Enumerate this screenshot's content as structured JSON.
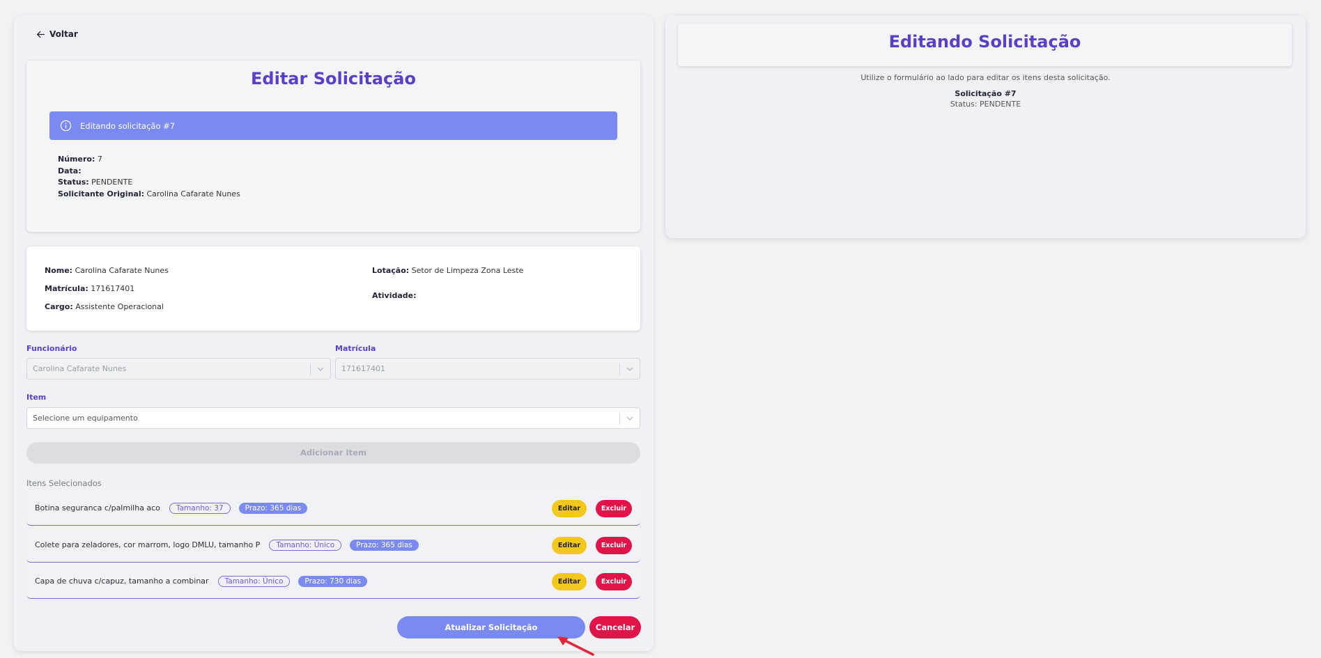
{
  "back_label": "Voltar",
  "left": {
    "title": "Editar Solicitação",
    "alert_text": "Editando solicitação #7",
    "details": [
      {
        "label": "Número:",
        "value": " 7"
      },
      {
        "label": "Data:",
        "value": ""
      },
      {
        "label": "Status:",
        "value": " PENDENTE"
      },
      {
        "label": "Solicitante Original:",
        "value": " Carolina Cafarate Nunes"
      }
    ]
  },
  "employee_info": {
    "nome_label": "Nome:",
    "nome": " Carolina Cafarate Nunes",
    "matricula_label": "Matrícula:",
    "matricula": " 171617401",
    "cargo_label": "Cargo:",
    "cargo": " Assistente Operacional",
    "lotacao_label": "Lotação:",
    "lotacao": " Setor de Limpeza Zona Leste",
    "atividade_label": "Atividade:",
    "atividade": ""
  },
  "form": {
    "funcionario_label": "Funcionário",
    "funcionario_value": "Carolina Cafarate Nunes",
    "matricula_label": "Matrícula",
    "matricula_value": "171617401",
    "item_label": "Item",
    "item_placeholder": "Selecione um equipamento",
    "add_button": "Adicionar Item"
  },
  "selected_items_label": "Itens Selecionados",
  "items": [
    {
      "name": "Botina seguranca c/palmilha aco",
      "size": "Tamanho: 37",
      "deadline": "Prazo: 365 dias"
    },
    {
      "name": "Colete para zeladores, cor marrom, logo DMLU, tamanho P",
      "size": "Tamanho: Único",
      "deadline": "Prazo: 365 dias"
    },
    {
      "name": "Capa de chuva c/capuz, tamanho a combinar",
      "size": "Tamanho: Único",
      "deadline": "Prazo: 730 dias"
    }
  ],
  "item_actions": {
    "edit": "Editar",
    "delete": "Excluir"
  },
  "actions": {
    "update": "Atualizar Solicitação",
    "cancel": "Cancelar"
  },
  "right": {
    "title": "Editando Solicitação",
    "description": "Utilize o formulário ao lado para editar os itens desta solicitação.",
    "request": "Solicitação #7",
    "status": "Status: PENDENTE"
  },
  "colors": {
    "accent": "#5b3fc8",
    "alert": "#7b8af0",
    "edit": "#f2c81c",
    "delete": "#e01449"
  }
}
